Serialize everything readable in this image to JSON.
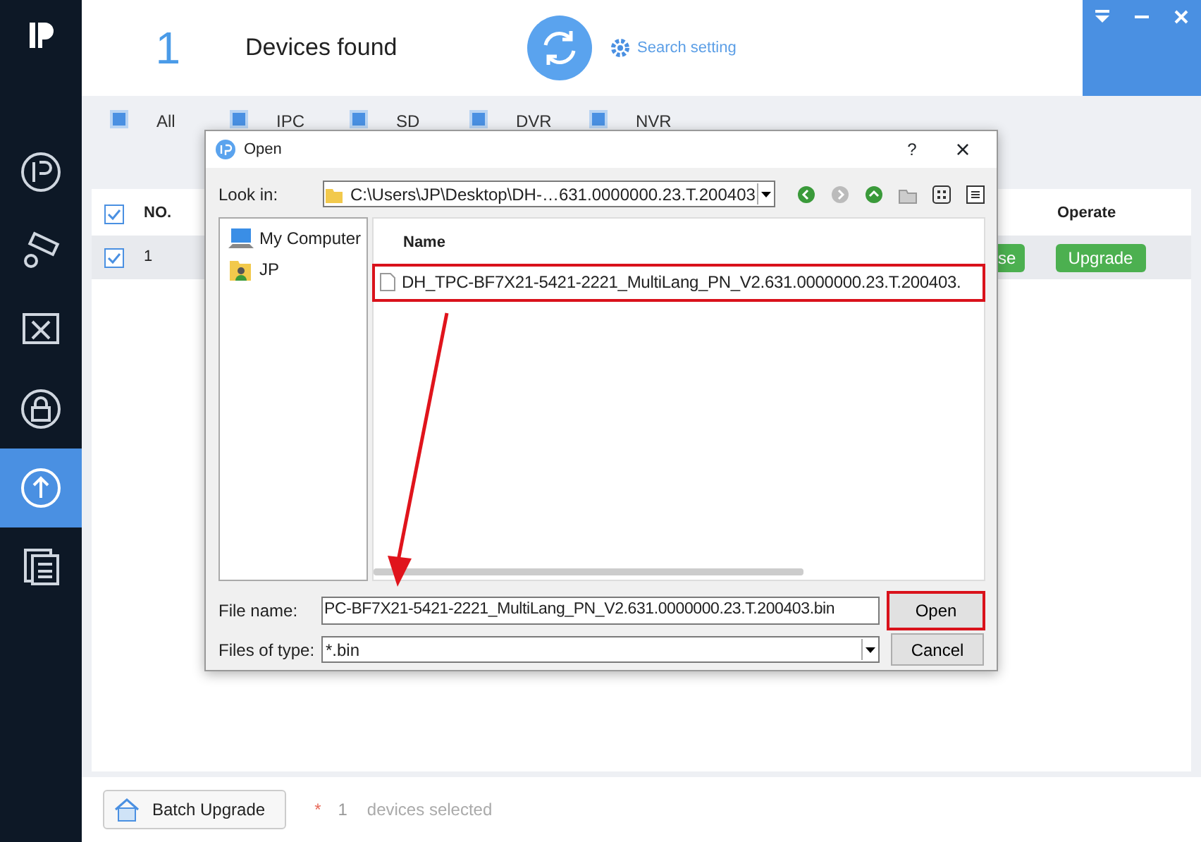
{
  "header": {
    "count": "1",
    "title": "Devices found",
    "search_setting": "Search setting"
  },
  "filters": [
    {
      "label": "All",
      "checked": true
    },
    {
      "label": "IPC",
      "checked": true
    },
    {
      "label": "SD",
      "checked": true
    },
    {
      "label": "DVR",
      "checked": true
    },
    {
      "label": "NVR",
      "checked": true
    }
  ],
  "sidebar": {
    "items": [
      {
        "selected": false
      },
      {
        "selected": false
      },
      {
        "selected": false
      },
      {
        "selected": false
      },
      {
        "selected": true
      },
      {
        "selected": false
      }
    ]
  },
  "table": {
    "header": {
      "checked": true,
      "no": "NO.",
      "operate": "Operate"
    },
    "rows": [
      {
        "checked": true,
        "no": "1",
        "button_partial": "se",
        "button": "Upgrade"
      }
    ]
  },
  "dialog": {
    "title": "Open",
    "help": "?",
    "close": "×",
    "look_in_label": "Look in:",
    "look_in": "C:\\Users\\JP\\Desktop\\DH-…631.0000000.23.T.200403",
    "places": [
      "My Computer",
      "JP"
    ],
    "column": "Name",
    "files": [
      {
        "name": "DH_TPC-BF7X21-5421-2221_MultiLang_PN_V2.631.0000000.23.T.200403.",
        "highlighted": true
      }
    ],
    "file_name_label": "File name:",
    "file_name": "PC-BF7X21-5421-2221_MultiLang_PN_V2.631.0000000.23.T.200403.bin",
    "type_label": "Files of type:",
    "type": "*.bin",
    "open": {
      "label": "Open",
      "highlighted": true
    },
    "cancel": {
      "label": "Cancel",
      "highlighted": false
    }
  },
  "footer": {
    "button": "Batch Upgrade",
    "star": "*",
    "count": "1",
    "text": "devices selected"
  }
}
